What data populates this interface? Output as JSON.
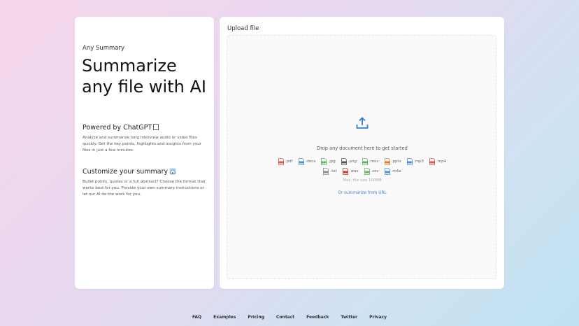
{
  "left": {
    "eyebrow": "Any Summary",
    "hero": "Summarize any file with AI",
    "section1": {
      "title": "Powered by ChatGPT",
      "body": "Analyze and summarize long interview audio or video files quickly. Get the key points, highlights and insights from your files in just a few minutes."
    },
    "section2": {
      "title": "Customize your summary",
      "body": "Bullet points, quotes or a full abstract? Choose the format that works best for you. Provide your own summary instructions or let our AI do the work for you."
    }
  },
  "upload": {
    "title": "Upload file",
    "drop_text": "Drop any document here to get started",
    "file_types_row1": [
      {
        "label": ".pdf",
        "color": "#e5534b"
      },
      {
        "label": ".docx",
        "color": "#4a90d9"
      },
      {
        "label": ".jpg",
        "color": "#5cb85c"
      },
      {
        "label": ".png",
        "color": "#555555"
      },
      {
        "label": ".mov",
        "color": "#5cb85c"
      },
      {
        "label": ".pptx",
        "color": "#e8793a"
      },
      {
        "label": ".mp3",
        "color": "#4a90d9"
      },
      {
        "label": ".mp4",
        "color": "#e5534b"
      }
    ],
    "file_types_row2": [
      {
        "label": ".txt",
        "color": "#888888"
      },
      {
        "label": ".wav",
        "color": "#d0342c"
      },
      {
        "label": ".csv",
        "color": "#5cb85c"
      },
      {
        "label": ".m4a",
        "color": "#4a90d9"
      }
    ],
    "max_size": "Max. file size 100MB",
    "url_link": "Or summarize from URL",
    "accent_color": "#2f7fd1"
  },
  "footer": {
    "links": [
      "FAQ",
      "Examples",
      "Pricing",
      "Contact",
      "Feedback",
      "Twitter",
      "Privacy"
    ]
  }
}
